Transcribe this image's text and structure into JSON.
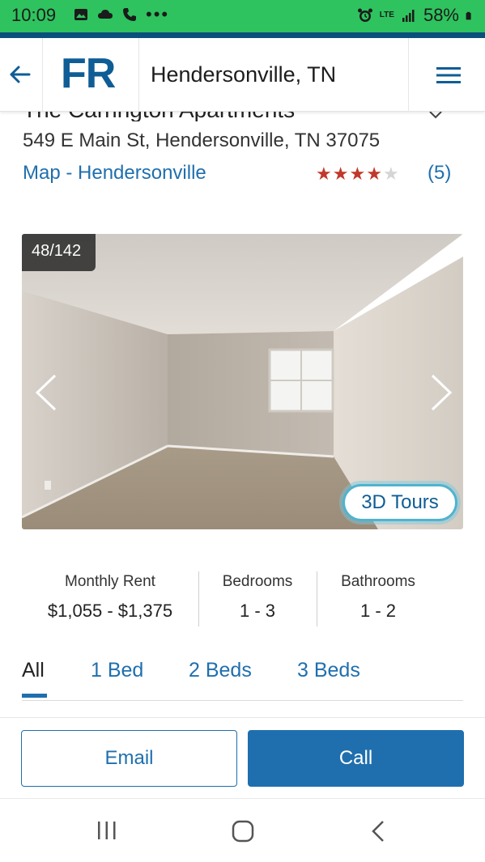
{
  "status_bar": {
    "time": "10:09",
    "dots": "•••",
    "lte": "LTE",
    "battery": "58%",
    "icons": [
      "image-icon",
      "cloud-icon",
      "phone-icon",
      "alarm-icon",
      "signal-icon",
      "battery-icon"
    ]
  },
  "header": {
    "logo": "FR",
    "city": "Hendersonville, TN",
    "icons": [
      "back-arrow-icon",
      "hamburger-menu-icon"
    ]
  },
  "property": {
    "title": "The Carrington Apartments",
    "address": "549 E Main St, Hendersonville, TN 37075",
    "map_link": "Map - Hendersonville",
    "rating": 4,
    "rating_max": 5,
    "reviews": "(5)",
    "star_colors": {
      "filled": "#c0392b",
      "empty": "#d5d5d5"
    }
  },
  "gallery": {
    "counter": "48/142",
    "tours_label": "3D Tours"
  },
  "stats": [
    {
      "label": "Monthly Rent",
      "value": "$1,055 - $1,375"
    },
    {
      "label": "Bedrooms",
      "value": "1 - 3"
    },
    {
      "label": "Bathrooms",
      "value": "1 - 2"
    }
  ],
  "tabs": [
    {
      "label": "All",
      "active": true
    },
    {
      "label": "1 Bed",
      "active": false
    },
    {
      "label": "2 Beds",
      "active": false
    },
    {
      "label": "3 Beds",
      "active": false
    }
  ],
  "actions": {
    "email": "Email",
    "call": "Call"
  },
  "colors": {
    "status_green": "#2ec35e",
    "brand_blue": "#0e5d96",
    "link_blue": "#1f6fae"
  },
  "navbar": {
    "icons": [
      "recent-apps-icon",
      "home-icon",
      "back-icon"
    ]
  }
}
